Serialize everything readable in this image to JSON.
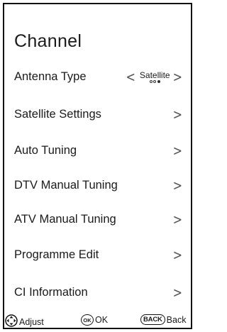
{
  "menu": {
    "title": "Channel",
    "antenna": {
      "label": "Antenna Type",
      "value": "Satellite",
      "left_arrow": "<",
      "right_arrow": ">",
      "page_indicator": {
        "count": 3,
        "selected": 3
      }
    },
    "items": [
      {
        "label": "Satellite Settings",
        "arrow": ">"
      },
      {
        "label": "Auto Tuning",
        "arrow": ">"
      },
      {
        "label": "DTV Manual Tuning",
        "arrow": ">"
      },
      {
        "label": "ATV Manual Tuning",
        "arrow": ">"
      },
      {
        "label": "Programme Edit",
        "arrow": ">"
      },
      {
        "label": "CI Information",
        "arrow": ">"
      }
    ]
  },
  "footer": {
    "adjust_label": "Adjust",
    "ok_badge": "OK",
    "ok_label": "OK",
    "back_badge": "BACK",
    "back_label": "Back"
  },
  "icons": {
    "adjust": "dpad-icon"
  }
}
